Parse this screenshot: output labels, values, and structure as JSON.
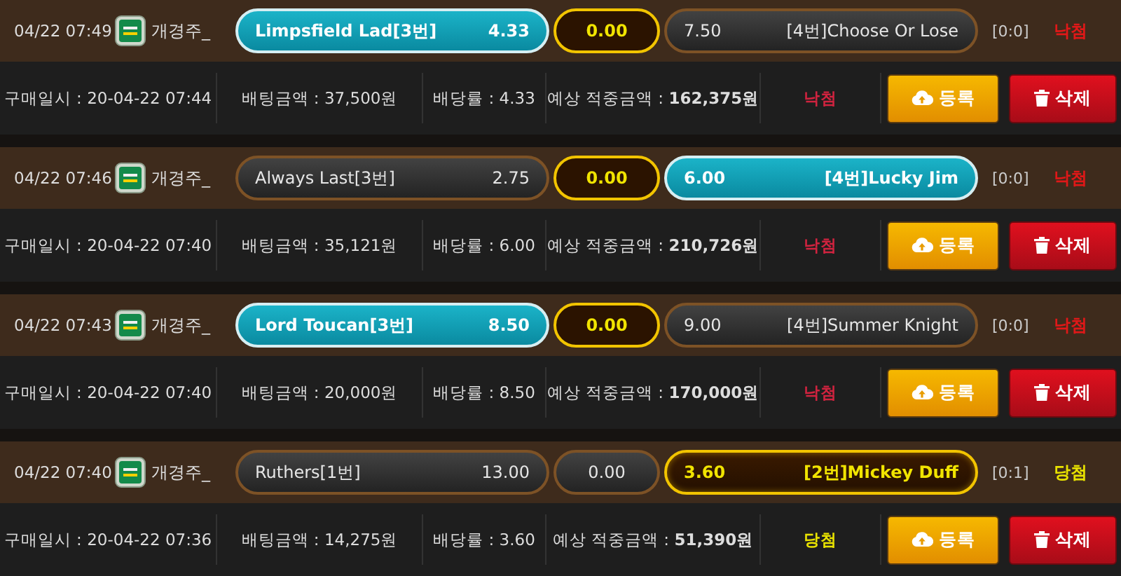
{
  "bets": [
    {
      "time": "04/22 07:49",
      "game": "개경주_",
      "home": {
        "label": "Limpsfield Lad[3번]",
        "odds": "4.33",
        "selected": true,
        "result": false
      },
      "draw": {
        "odds": "0.00",
        "selected": false,
        "result": true
      },
      "away": {
        "label": "[4번]Choose Or Lose",
        "odds": "7.50",
        "selected": false,
        "result": false
      },
      "score": "[0:0]",
      "outcome": {
        "text": "낙첨",
        "kind": "lose"
      },
      "purchase": "구매일시 : 20-04-22 07:44",
      "stake": "배팅금액 : 37,500원",
      "rate": "배당률 : 4.33",
      "expected": "예상 적중금액 : **162,375원**",
      "status": {
        "text": "낙첨",
        "kind": "lose"
      },
      "buttons": [
        "등록",
        "삭제"
      ]
    },
    {
      "time": "04/22 07:46",
      "game": "개경주_",
      "home": {
        "label": "Always Last[3번]",
        "odds": "2.75",
        "selected": false,
        "result": false
      },
      "draw": {
        "odds": "0.00",
        "selected": false,
        "result": true
      },
      "away": {
        "label": "[4번]Lucky Jim",
        "odds": "6.00",
        "selected": true,
        "result": false
      },
      "score": "[0:0]",
      "outcome": {
        "text": "낙첨",
        "kind": "lose"
      },
      "purchase": "구매일시 : 20-04-22 07:40",
      "stake": "배팅금액 : 35,121원",
      "rate": "배당률 : 6.00",
      "expected": "예상 적중금액 : **210,726원**",
      "status": {
        "text": "낙첨",
        "kind": "lose"
      },
      "buttons": [
        "등록",
        "삭제"
      ]
    },
    {
      "time": "04/22 07:43",
      "game": "개경주_",
      "home": {
        "label": "Lord Toucan[3번]",
        "odds": "8.50",
        "selected": true,
        "result": false
      },
      "draw": {
        "odds": "0.00",
        "selected": false,
        "result": true
      },
      "away": {
        "label": "[4번]Summer Knight",
        "odds": "9.00",
        "selected": false,
        "result": false
      },
      "score": "[0:0]",
      "outcome": {
        "text": "낙첨",
        "kind": "lose"
      },
      "purchase": "구매일시 : 20-04-22 07:40",
      "stake": "배팅금액 : 20,000원",
      "rate": "배당률 : 8.50",
      "expected": "예상 적중금액 : **170,000원**",
      "status": {
        "text": "낙첨",
        "kind": "lose"
      },
      "buttons": [
        "등록",
        "삭제"
      ]
    },
    {
      "time": "04/22 07:40",
      "game": "개경주_",
      "home": {
        "label": "Ruthers[1번]",
        "odds": "13.00",
        "selected": false,
        "result": false
      },
      "draw": {
        "odds": "0.00",
        "selected": false,
        "result": false
      },
      "away": {
        "label": "[2번]Mickey Duff",
        "odds": "3.60",
        "selected": true,
        "result": true
      },
      "score": "[0:1]",
      "outcome": {
        "text": "당첨",
        "kind": "win"
      },
      "purchase": "구매일시 : 20-04-22 07:36",
      "stake": "배팅금액 : 14,275원",
      "rate": "배당률 : 3.60",
      "expected": "예상 적중금액 : **51,390원**",
      "status": {
        "text": "당첨",
        "kind": "win"
      },
      "buttons": [
        "등록",
        "삭제"
      ]
    }
  ]
}
